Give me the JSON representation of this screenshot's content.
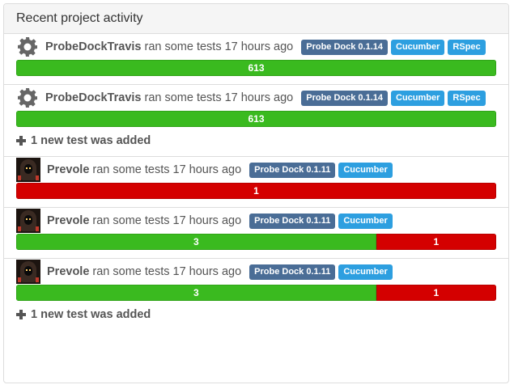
{
  "panel": {
    "title": "Recent project activity"
  },
  "colors": {
    "passed": "#3aba1f",
    "failed": "#d40000",
    "project_tag": "#4a6d96",
    "tech_tag": "#2d9fe0"
  },
  "activities": [
    {
      "user": "ProbeDockTravis",
      "avatar_icon": "gear-icon",
      "action": "ran some tests",
      "time": "17 hours ago",
      "project_tag": "Probe Dock 0.1.14",
      "tech_tags": [
        "Cucumber",
        "RSpec"
      ],
      "passed": 613,
      "failed": 0,
      "passed_label": "613",
      "failed_label": "",
      "added_note": ""
    },
    {
      "user": "ProbeDockTravis",
      "avatar_icon": "gear-icon",
      "action": "ran some tests",
      "time": "17 hours ago",
      "project_tag": "Probe Dock 0.1.14",
      "tech_tags": [
        "Cucumber",
        "RSpec"
      ],
      "passed": 613,
      "failed": 0,
      "passed_label": "613",
      "failed_label": "",
      "added_note": "1 new test was added"
    },
    {
      "user": "Prevole",
      "avatar_icon": "user-avatar",
      "action": "ran some tests",
      "time": "17 hours ago",
      "project_tag": "Probe Dock 0.1.11",
      "tech_tags": [
        "Cucumber"
      ],
      "passed": 0,
      "failed": 1,
      "passed_label": "",
      "failed_label": "1",
      "added_note": ""
    },
    {
      "user": "Prevole",
      "avatar_icon": "user-avatar",
      "action": "ran some tests",
      "time": "17 hours ago",
      "project_tag": "Probe Dock 0.1.11",
      "tech_tags": [
        "Cucumber"
      ],
      "passed": 3,
      "failed": 1,
      "passed_label": "3",
      "failed_label": "1",
      "added_note": ""
    },
    {
      "user": "Prevole",
      "avatar_icon": "user-avatar",
      "action": "ran some tests",
      "time": "17 hours ago",
      "project_tag": "Probe Dock 0.1.11",
      "tech_tags": [
        "Cucumber"
      ],
      "passed": 3,
      "failed": 1,
      "passed_label": "3",
      "failed_label": "1",
      "added_note": "1 new test was added"
    }
  ]
}
